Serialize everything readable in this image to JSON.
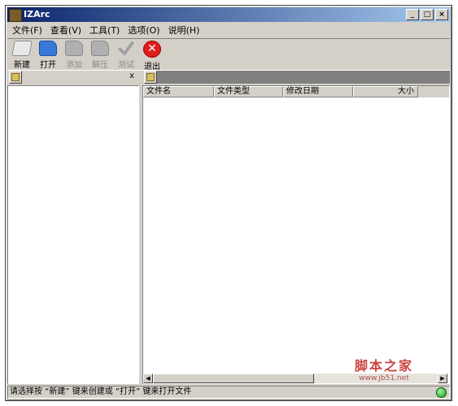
{
  "window": {
    "title": "IZArc",
    "buttons": {
      "minimize": "_",
      "maximize": "□",
      "close": "×"
    }
  },
  "menu": [
    "文件(F)",
    "查看(V)",
    "工具(T)",
    "选项(O)",
    "说明(H)"
  ],
  "toolbar": [
    {
      "label": "新建",
      "icon": "new-archive-icon",
      "enabled": true
    },
    {
      "label": "打开",
      "icon": "open-archive-icon",
      "enabled": true
    },
    {
      "label": "添加",
      "icon": "add-files-icon",
      "enabled": false
    },
    {
      "label": "解压",
      "icon": "extract-icon",
      "enabled": false
    },
    {
      "label": "测试",
      "icon": "test-check-icon",
      "enabled": false
    },
    {
      "label": "退出",
      "icon": "exit-icon",
      "enabled": true
    }
  ],
  "left_pane": {
    "close_label": "x"
  },
  "file_list": {
    "columns": [
      "文件名",
      "文件类型",
      "修改日期",
      "大小"
    ]
  },
  "status": {
    "text": "请选择按 “新建” 键来创建或 “打开” 键来打开文件"
  },
  "watermark": {
    "big": "脚本之家",
    "small": "www.jb51.net"
  },
  "colors": {
    "title_start": "#0a246a",
    "title_end": "#a6caf0",
    "face": "#d4d0c8",
    "exit_red": "#e01e1e",
    "led_green": "#1a9a1a"
  }
}
